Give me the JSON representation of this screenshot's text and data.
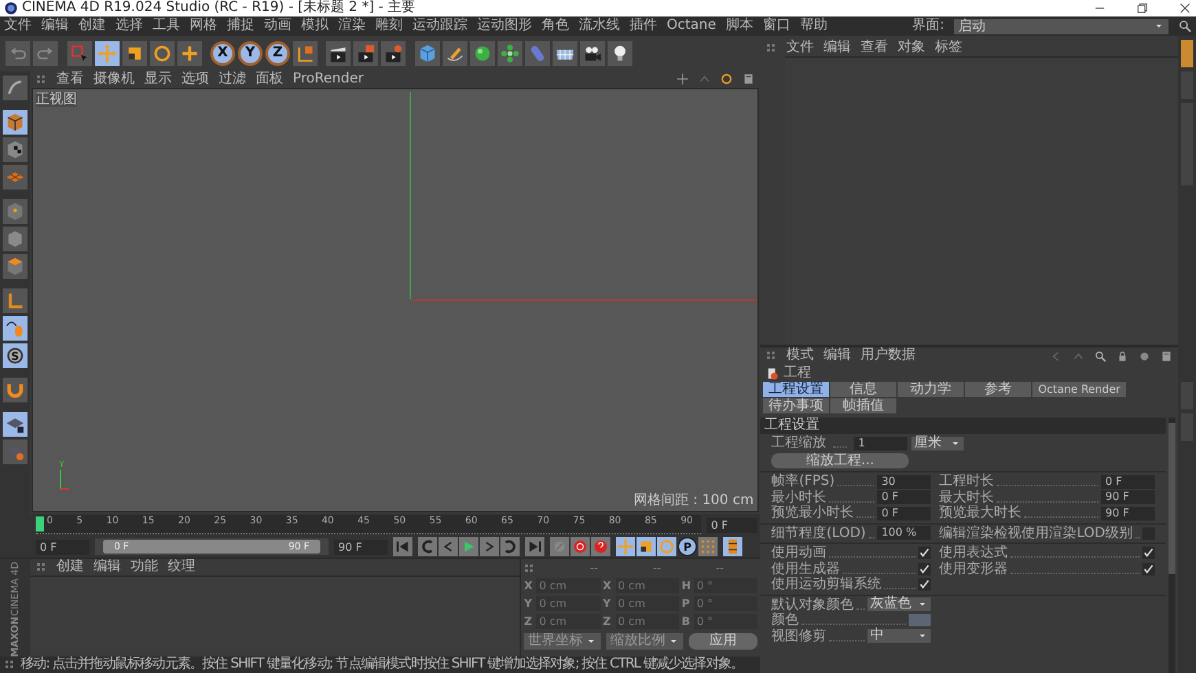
{
  "window": {
    "title": "CINEMA 4D R19.024 Studio (RC - R19) - [未标题 2 *] - 主要"
  },
  "menu": [
    "文件",
    "编辑",
    "创建",
    "选择",
    "工具",
    "网格",
    "捕捉",
    "动画",
    "模拟",
    "渲染",
    "雕刻",
    "运动跟踪",
    "运动图形",
    "角色",
    "流水线",
    "插件",
    "Octane",
    "脚本",
    "窗口",
    "帮助"
  ],
  "layout": {
    "label": "界面:",
    "value": "启动"
  },
  "toolbar": {
    "tools": [
      {
        "selected": false
      },
      {
        "selected": false
      },
      {
        "selected": false
      },
      {
        "selected": true
      },
      {
        "selected": false
      },
      {
        "selected": false
      },
      {
        "selected": false
      }
    ],
    "axes": [
      {
        "label": "X",
        "selected": true
      },
      {
        "label": "Y",
        "selected": true
      },
      {
        "label": "Z",
        "selected": true
      }
    ]
  },
  "mode_tools": [
    {
      "selected": false
    },
    {
      "selected": true
    },
    {
      "selected": false
    },
    {
      "selected": false
    },
    {
      "selected": false
    },
    {
      "selected": false
    },
    {
      "selected": false
    },
    {
      "selected": false
    },
    {
      "selected": true
    },
    {
      "label": "S",
      "selected": true
    },
    {
      "selected": false
    },
    {
      "selected": true
    },
    {
      "selected": false
    }
  ],
  "viewport": {
    "menu": [
      "查看",
      "摄像机",
      "显示",
      "选项",
      "过滤",
      "面板",
      "ProRender"
    ],
    "name": "正视图",
    "axis_label": "Y",
    "grid_spacing": "网格间距 : 100 cm"
  },
  "timeline": {
    "ticks": [
      "0",
      "5",
      "10",
      "15",
      "20",
      "25",
      "30",
      "35",
      "40",
      "45",
      "50",
      "55",
      "60",
      "65",
      "70",
      "75",
      "80",
      "85",
      "90"
    ],
    "level": 0,
    "current": "0 F"
  },
  "side_tabs": [
    {
      "selected": true
    },
    {
      "selected": false
    },
    {
      "selected": false
    },
    {
      "selected": false
    },
    {
      "selected": false
    }
  ],
  "transport": {
    "start": "0 F",
    "range": {
      "level": 1
    },
    "range_start": "0 F",
    "range_end": "90 F",
    "end": "90 F",
    "p_label": "P"
  },
  "materials": {
    "menu": [
      "创建",
      "编辑",
      "功能",
      "纹理"
    ],
    "logo_top": "MAXON",
    "logo_bottom": "CINEMA 4D"
  },
  "coordinates": {
    "headers": [
      "--",
      "--",
      "--"
    ],
    "rows": [
      {
        "pos_axis": "X",
        "pos": "0 cm",
        "size_axis": "X",
        "size": "0 cm",
        "rot_axis": "H",
        "rot": "0 °"
      },
      {
        "pos_axis": "Y",
        "pos": "0 cm",
        "size_axis": "Y",
        "size": "0 cm",
        "rot_axis": "P",
        "rot": "0 °"
      },
      {
        "pos_axis": "Z",
        "pos": "0 cm",
        "size_axis": "Z",
        "size": "0 cm",
        "rot_axis": "B",
        "rot": "0 °"
      }
    ],
    "mode": "世界坐标",
    "size_mode": "缩放比例",
    "apply": "应用"
  },
  "status_bar": "移动: 点击并拖动鼠标移动元素。按住 SHIFT 键量化移动; 节点编辑模式时按住 SHIFT 键增加选择对象; 按住 CTRL 键减少选择对象。",
  "objects": {
    "menu": [
      "文件",
      "编辑",
      "查看",
      "对象",
      "标签"
    ]
  },
  "attributes": {
    "menu": [
      "模式",
      "编辑",
      "用户数据"
    ],
    "title": "工程",
    "tabs": [
      [
        {
          "label": "工程设置",
          "selected": true
        },
        {
          "label": "信息",
          "selected": false
        },
        {
          "label": "动力学",
          "selected": false
        },
        {
          "label": "参考",
          "selected": false
        },
        {
          "label": "Octane Render",
          "selected": false
        }
      ],
      [
        {
          "label": "待办事项",
          "selected": false
        },
        {
          "label": "帧插值",
          "selected": false
        }
      ]
    ],
    "section": "工程设置",
    "scale": {
      "label": "工程缩放",
      "value": "1",
      "unit": "厘米"
    },
    "scale_button": "缩放工程...",
    "groups": [
      {
        "rows": [
          [
            {
              "kind": "field",
              "label": "帧率(FPS)",
              "value": "30"
            },
            {
              "kind": "field",
              "label": "工程时长",
              "value": "0 F"
            }
          ],
          [
            {
              "kind": "field",
              "label": "最小时长",
              "value": "0 F"
            },
            {
              "kind": "field",
              "label": "最大时长",
              "value": "90 F"
            }
          ],
          [
            {
              "kind": "field",
              "label": "预览最小时长",
              "value": "0 F"
            },
            {
              "kind": "field",
              "label": "预览最大时长",
              "value": "90 F"
            }
          ]
        ]
      },
      {
        "rows": [
          [
            {
              "kind": "field",
              "label": "细节程度(LOD)",
              "value": "100 %"
            },
            {
              "kind": "check",
              "label": "编辑渲染检视使用渲染LOD级别",
              "checked": false
            }
          ]
        ]
      },
      {
        "rows": [
          [
            {
              "kind": "check",
              "label": "使用动画",
              "checked": true
            },
            {
              "kind": "check",
              "label": "使用表达式",
              "checked": true
            }
          ],
          [
            {
              "kind": "check",
              "label": "使用生成器",
              "checked": true
            },
            {
              "kind": "check",
              "label": "使用变形器",
              "checked": true
            }
          ],
          [
            {
              "kind": "check",
              "label": "使用运动剪辑系统",
              "checked": true
            }
          ]
        ]
      },
      {
        "rows": [
          [
            {
              "kind": "dropdown",
              "label": "默认对象颜色",
              "value": "灰蓝色"
            }
          ],
          [
            {
              "kind": "swatch",
              "label": "颜色",
              "color": "#5b6573"
            }
          ],
          [
            {
              "kind": "dropdown",
              "label": "视图修剪",
              "value": "中"
            }
          ]
        ]
      }
    ]
  }
}
